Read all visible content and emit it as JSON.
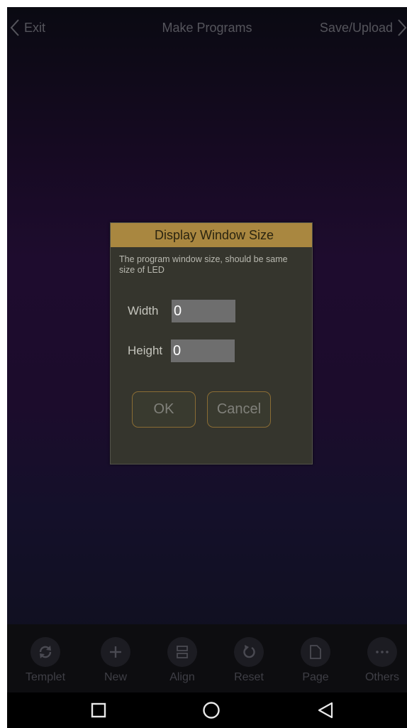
{
  "topbar": {
    "exit_label": "Exit",
    "title": "Make Programs",
    "save_label": "Save/Upload"
  },
  "dialog": {
    "title": "Display Window Size",
    "description": "The program window size, should be same size of LED",
    "width_label": "Width",
    "width_value": "0",
    "height_label": "Height",
    "height_value": "0",
    "ok_label": "OK",
    "cancel_label": "Cancel"
  },
  "toolbar": {
    "items": [
      {
        "label": "Templet",
        "icon": "sync-icon"
      },
      {
        "label": "New",
        "icon": "plus-icon"
      },
      {
        "label": "Align",
        "icon": "align-icon"
      },
      {
        "label": "Reset",
        "icon": "reset-icon"
      },
      {
        "label": "Page",
        "icon": "page-icon"
      },
      {
        "label": "Others",
        "icon": "more-icon"
      }
    ]
  },
  "navbar": {
    "buttons": [
      "recent-apps",
      "home",
      "back"
    ]
  },
  "colors": {
    "dialog_header": "#a98740",
    "dialog_body": "#35352d",
    "button_border": "#8a6c34",
    "input_bg": "#6e6e6e"
  }
}
